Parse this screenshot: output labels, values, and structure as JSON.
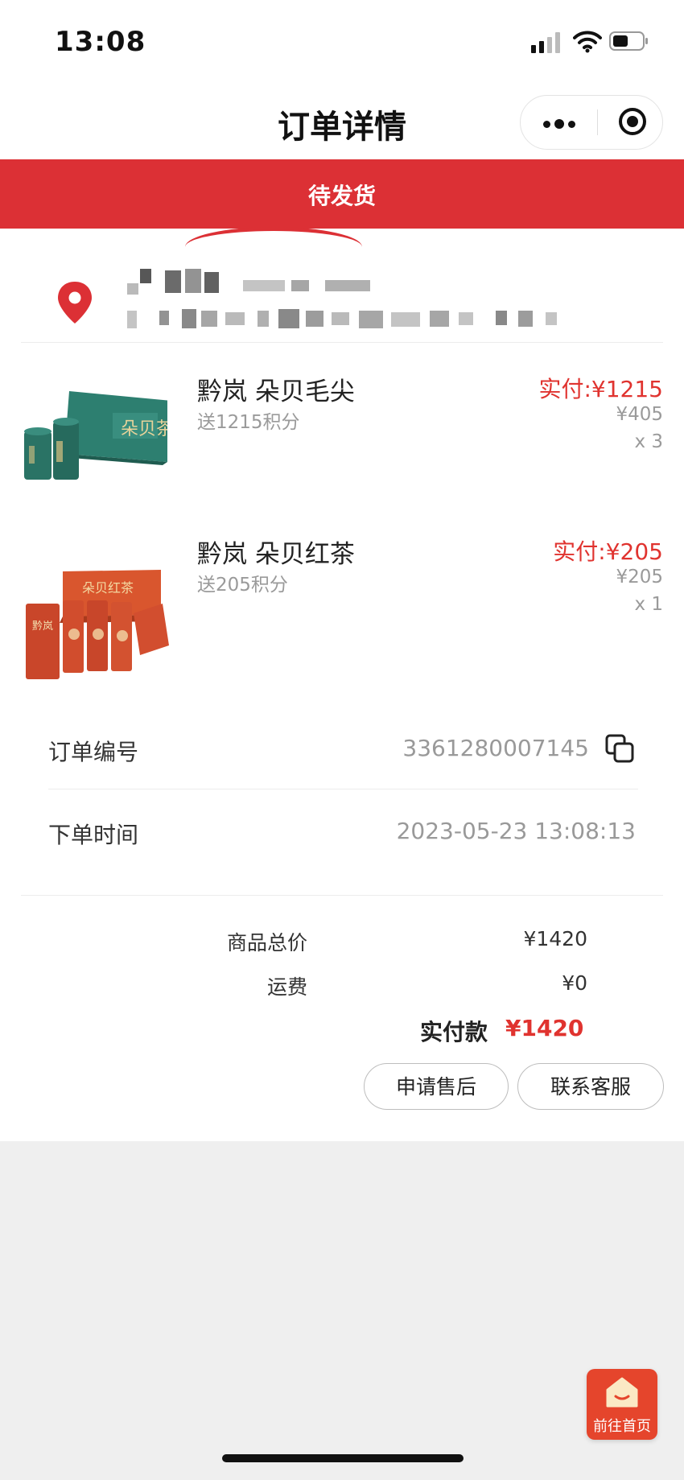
{
  "status_bar": {
    "time": "13:08"
  },
  "nav": {
    "title": "订单详情"
  },
  "order_status": "待发货",
  "products": [
    {
      "name": "黔岚 朵贝毛尖",
      "points": "送1215积分",
      "paid": "实付:¥1215",
      "unit_price": "¥405",
      "quantity": "x 3"
    },
    {
      "name": "黔岚 朵贝红茶",
      "points": "送205积分",
      "paid": "实付:¥205",
      "unit_price": "¥205",
      "quantity": "x 1"
    }
  ],
  "order_info": {
    "number_label": "订单编号",
    "number_value": "3361280007145",
    "time_label": "下单时间",
    "time_value": "2023-05-23 13:08:13"
  },
  "summary": {
    "goods_total_label": "商品总价",
    "goods_total_value": "¥1420",
    "shipping_label": "运费",
    "shipping_value": "¥0",
    "paid_label": "实付款",
    "paid_value": "¥1420"
  },
  "actions": {
    "after_sale": "申请售后",
    "contact_service": "联系客服"
  },
  "home_button": {
    "label": "前往首页"
  },
  "colors": {
    "accent_red": "#dc3035",
    "price_red": "#e0332f",
    "home_orange": "#e5452c"
  },
  "icons": [
    "location-pin-icon",
    "copy-icon",
    "more-dots-icon",
    "target-icon",
    "home-icon"
  ]
}
